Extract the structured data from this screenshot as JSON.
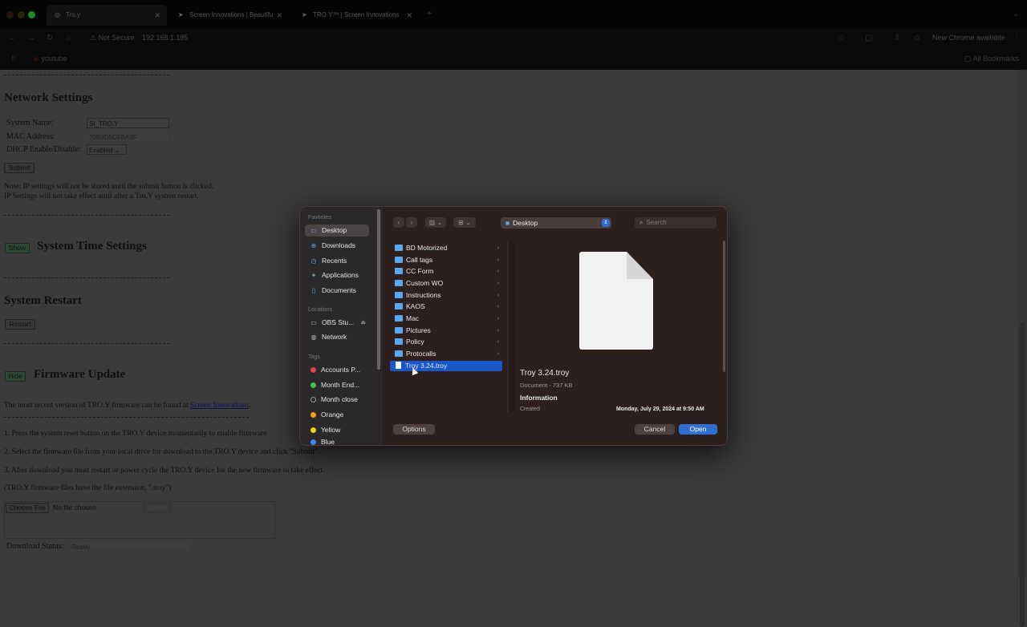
{
  "browser": {
    "tabs": [
      {
        "title": "Tro.y"
      },
      {
        "title": "Screen Innovations | Beautifu"
      },
      {
        "title": "TRO.Y™ | Screen Innovations"
      }
    ],
    "new_tab": "+",
    "address": {
      "security": "Not Secure",
      "url": "192.168.1.185"
    },
    "chrome_available": "New Chrome available",
    "bookmark": "youtube",
    "all_bookmarks": "All Bookmarks"
  },
  "page": {
    "network": {
      "title": "Network Settings",
      "system_name_label": "System Name:",
      "system_name_value": "SI_TRO.Y",
      "mac_label": "MAC Address:",
      "mac_value": "70B3D5CFBA9F",
      "dhcp_label": "DHCP Enable/Disable:",
      "dhcp_value": "Enabled",
      "submit": "Submit",
      "note1": "Note: IP settings will not be stored until the submit button is clicked.",
      "note2": "IP Settings will not take effect until after a Tro.Y system restart."
    },
    "time": {
      "show": "Show",
      "title": "System Time Settings"
    },
    "restart": {
      "title": "System Restart",
      "button": "Restart"
    },
    "firmware": {
      "hide": "Hide",
      "title": "Firmware Update",
      "intro": "The most recent version of TRO.Y firmware can be found at",
      "link": "Screen Innovations",
      "intro_end": ".",
      "step1": "1. Press the system reset button on the TRO.Y device momentarily to enable firmware",
      "step2": "2. Select the firmware file from your local drive for download to the TRO.Y device and click \"Submit\".",
      "step3": "3. After download you must restart or power cycle the TRO.Y device for the new firmware to take effect.",
      "ext_note": "(TRO.Y firmware files have the file extension, \".troy\")",
      "choose_file": "Choose File",
      "no_file": "No file chosen",
      "submit": "Submit",
      "status_label": "Download Status:",
      "status_value": "Ready"
    }
  },
  "dialog": {
    "favorites_header": "Favorites",
    "favorites": [
      {
        "label": "Desktop",
        "icon": "desktop-icon"
      },
      {
        "label": "Downloads",
        "icon": "downloads-icon"
      },
      {
        "label": "Recents",
        "icon": "clock-icon"
      },
      {
        "label": "Applications",
        "icon": "applications-icon"
      },
      {
        "label": "Documents",
        "icon": "document-icon"
      }
    ],
    "locations_header": "Locations",
    "locations": [
      {
        "label": "OBS Stu...",
        "icon": "drive-icon"
      },
      {
        "label": "Network",
        "icon": "globe-icon"
      }
    ],
    "tags_header": "Tags",
    "tags": [
      {
        "label": "Accounts P...",
        "color": "#e0444a"
      },
      {
        "label": "Month End...",
        "color": "#3fc54a"
      },
      {
        "label": "Month close",
        "color": "#2a2828"
      },
      {
        "label": "Orange",
        "color": "#f0a020"
      },
      {
        "label": "Yellow",
        "color": "#f2d21c"
      },
      {
        "label": "Blue",
        "color": "#3a88f0"
      }
    ],
    "location": "Desktop",
    "search_placeholder": "Search",
    "files": [
      {
        "name": "BD Motorized",
        "type": "folder"
      },
      {
        "name": "Call tags",
        "type": "folder"
      },
      {
        "name": "CC Form",
        "type": "folder"
      },
      {
        "name": "Custom WO",
        "type": "folder"
      },
      {
        "name": "Instructions",
        "type": "folder"
      },
      {
        "name": "KAOS",
        "type": "folder"
      },
      {
        "name": "Mac",
        "type": "folder"
      },
      {
        "name": "Pictures",
        "type": "folder"
      },
      {
        "name": "Policy",
        "type": "folder"
      },
      {
        "name": "Protocalls",
        "type": "folder"
      },
      {
        "name": "Troy 3.24.troy",
        "type": "file",
        "selected": true
      }
    ],
    "preview": {
      "name": "Troy 3.24.troy",
      "kind": "Document - 737 KB",
      "info_header": "Information",
      "created_label": "Created",
      "created_value": "Monday, July 29, 2024 at 9:50 AM"
    },
    "options": "Options",
    "cancel": "Cancel",
    "open": "Open",
    "accent": "#1957c9"
  }
}
